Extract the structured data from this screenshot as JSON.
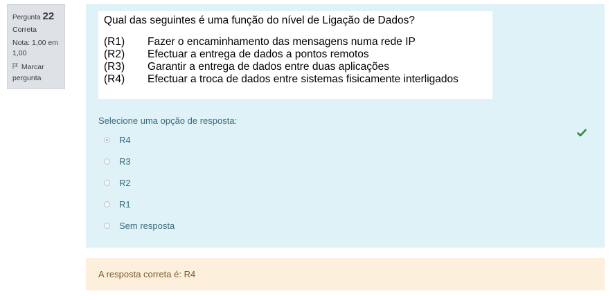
{
  "info": {
    "question_label": "Pergunta",
    "question_number": "22",
    "state": "Correta",
    "grade": "Nota: 1,00 em 1,00",
    "flag_label": "Marcar pergunta"
  },
  "question": {
    "text": "Qual das seguintes é uma função do nível de Ligação de Dados?",
    "items": [
      {
        "code": "(R1)",
        "text": "Fazer o encaminhamento das mensagens numa rede IP"
      },
      {
        "code": "(R2)",
        "text": "Efectuar a entrega de dados a pontos remotos"
      },
      {
        "code": "(R3)",
        "text": "Garantir a entrega de dados entre duas aplicações"
      },
      {
        "code": "(R4)",
        "text": "Efectuar a troca de dados entre sistemas fisicamente interligados"
      }
    ]
  },
  "answer": {
    "prompt": "Selecione uma opção de resposta:",
    "options": [
      {
        "label": "R4",
        "selected": true
      },
      {
        "label": "R3",
        "selected": false
      },
      {
        "label": "R2",
        "selected": false
      },
      {
        "label": "R1",
        "selected": false
      },
      {
        "label": "Sem resposta",
        "selected": false
      }
    ],
    "correct_icon": "check-icon"
  },
  "feedback": {
    "text": "A resposta correta é: R4"
  },
  "colors": {
    "content_bg": "#def2f8",
    "feedback_bg": "#fcefdc",
    "check": "#398439"
  }
}
